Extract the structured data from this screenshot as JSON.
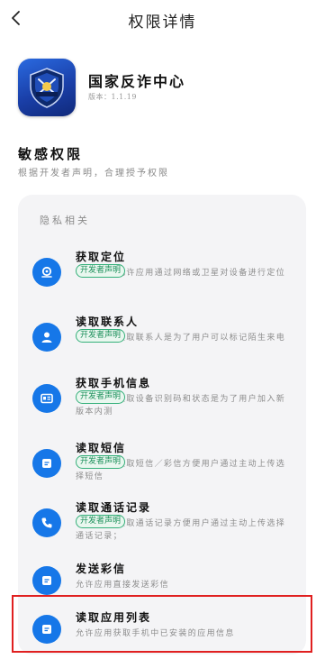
{
  "header": {
    "back_icon": "chevron-left-icon",
    "title": "权限详情"
  },
  "app": {
    "name": "国家反诈中心",
    "version": "版本：1.1.19",
    "logo_icon": "shield-icon"
  },
  "section": {
    "title": "敏感权限",
    "subtitle": "根据开发者声明，合理授予权限"
  },
  "group": {
    "label": "隐私相关"
  },
  "badge_label": "开发者声明",
  "permissions": [
    {
      "title": "获取定位",
      "desc": "允许应用通过网络或卫星对设备进行定位",
      "icon": "location-pin-icon",
      "has_badge": true
    },
    {
      "title": "读取联系人",
      "desc": "读取联系人是为了用户可以标记陌生来电",
      "icon": "person-icon",
      "has_badge": true
    },
    {
      "title": "获取手机信息",
      "desc": "读取设备识别码和状态是为了用户加入新版本内测",
      "icon": "id-card-icon",
      "has_badge": true
    },
    {
      "title": "读取短信",
      "desc": "读取短信／彩信方便用户通过主动上传选择短信",
      "icon": "message-icon",
      "has_badge": true
    },
    {
      "title": "读取通话记录",
      "desc": "读取通话记录方便用户通过主动上传选择通话记录；",
      "icon": "phone-icon",
      "has_badge": true
    },
    {
      "title": "发送彩信",
      "desc": "允许应用直接发送彩信",
      "icon": "message-icon",
      "has_badge": false
    },
    {
      "title": "读取应用列表",
      "desc": "允许应用获取手机中已安装的应用信息",
      "icon": "message-icon",
      "has_badge": false
    }
  ],
  "colors": {
    "accent": "#1677e8",
    "badge_border": "#35b07a",
    "highlight": "#e02020"
  }
}
